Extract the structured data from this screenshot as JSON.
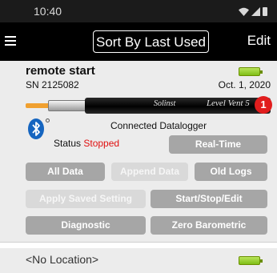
{
  "status_bar": {
    "time": "10:40",
    "icons": [
      "wifi-icon",
      "signal-icon",
      "battery-icon"
    ]
  },
  "app_bar": {
    "menu_icon": "menu-icon",
    "sort_label": "Sort By Last Used",
    "edit_label": "Edit"
  },
  "logger": {
    "name": "remote start",
    "serial": "SN 2125082",
    "date": "Oct. 1, 2020",
    "brand": "Solinst",
    "model": "Level Vent 5",
    "badge": "1",
    "battery_icon": "battery-full-icon",
    "connection_icon": "bluetooth-icon",
    "connection_text": "Connected Datalogger",
    "status_label": "Status",
    "status_value": "Stopped",
    "colors": {
      "status_value": "#e01010",
      "badge": "#e11d1d",
      "battery": "#7fbe16",
      "bluetooth": "#1565c0",
      "button": "#a6a6a6",
      "button_disabled": "#d9d9d9"
    }
  },
  "buttons": {
    "real_time": "Real-Time",
    "all_data": "All Data",
    "append_data": "Append Data",
    "old_logs": "Old Logs",
    "apply_saved_setting": "Apply Saved Setting",
    "start_stop_edit": "Start/Stop/Edit",
    "diagnostic": "Diagnostic",
    "zero_barometric": "Zero Barometric"
  },
  "footer": {
    "location": "<No Location>"
  }
}
